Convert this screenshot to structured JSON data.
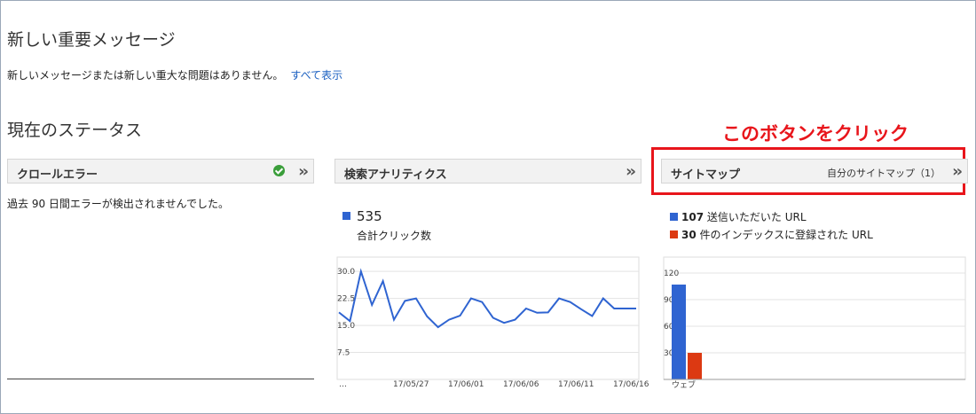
{
  "new_messages": {
    "title": "新しい重要メッセージ",
    "body": "新しいメッセージまたは新しい重大な問題はありません。",
    "show_all": "すべて表示"
  },
  "status": {
    "title": "現在のステータス"
  },
  "annotation": {
    "text": "このボタンをクリック",
    "color": "#e8151b"
  },
  "crawl_errors": {
    "header": "クロールエラー",
    "status_icon": "check-circle-icon",
    "message": "過去 90 日間エラーが検出されませんでした。"
  },
  "search_analytics": {
    "header": "検索アナリティクス",
    "total": "535",
    "total_label": "合計クリック数"
  },
  "sitemaps": {
    "header": "サイトマップ",
    "my_sitemaps": "自分のサイトマップ（1）",
    "legend": [
      {
        "count": "107",
        "label": "送信いただいた URL",
        "color": "#2f64d1"
      },
      {
        "count": "30",
        "label": "件のインデックスに登録された URL",
        "color": "#dc3912"
      }
    ]
  },
  "chart_data": [
    {
      "type": "line",
      "y_ticks": [
        "30.0",
        "22.5",
        "15.0",
        "7.5"
      ],
      "x_ticks": [
        "…",
        "17/05/27",
        "17/06/01",
        "17/06/06",
        "17/06/11",
        "17/06/16"
      ],
      "ylim": [
        0,
        32
      ],
      "series": [
        {
          "color": "#2f64d1",
          "values": [
            18.6,
            16.2,
            30.0,
            20.7,
            27.3,
            16.6,
            21.8,
            22.5,
            17.5,
            14.5,
            16.6,
            17.7,
            22.5,
            21.5,
            17.1,
            15.7,
            16.6,
            19.7,
            18.5,
            18.6,
            22.5,
            21.5,
            19.5,
            17.6,
            22.5,
            19.7,
            19.7,
            19.7
          ]
        }
      ]
    },
    {
      "type": "bar",
      "categories": [
        "ウェブ"
      ],
      "y_ticks": [
        "120",
        "90",
        "60",
        "30"
      ],
      "ylim": [
        0,
        130
      ],
      "series": [
        {
          "name": "送信いただいた URL",
          "values": [
            107
          ],
          "color": "#2f64d1"
        },
        {
          "name": "件のインデックスに登録された URL",
          "values": [
            30
          ],
          "color": "#dc3912"
        }
      ]
    }
  ]
}
